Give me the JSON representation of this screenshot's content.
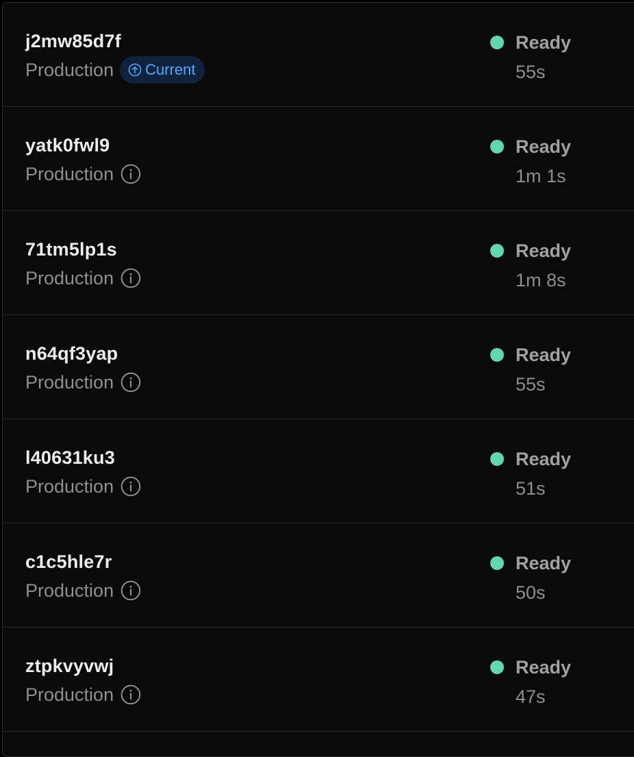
{
  "deployments": [
    {
      "id": "j2mw85d7f",
      "environment": "Production",
      "status": "Ready",
      "duration": "55s",
      "is_current": true,
      "current_label": "Current"
    },
    {
      "id": "yatk0fwl9",
      "environment": "Production",
      "status": "Ready",
      "duration": "1m 1s",
      "is_current": false
    },
    {
      "id": "71tm5lp1s",
      "environment": "Production",
      "status": "Ready",
      "duration": "1m 8s",
      "is_current": false
    },
    {
      "id": "n64qf3yap",
      "environment": "Production",
      "status": "Ready",
      "duration": "55s",
      "is_current": false
    },
    {
      "id": "l40631ku3",
      "environment": "Production",
      "status": "Ready",
      "duration": "51s",
      "is_current": false
    },
    {
      "id": "c1c5hle7r",
      "environment": "Production",
      "status": "Ready",
      "duration": "50s",
      "is_current": false
    },
    {
      "id": "ztpkvyvwj",
      "environment": "Production",
      "status": "Ready",
      "duration": "47s",
      "is_current": false
    }
  ],
  "colors": {
    "background": "#0a0a0a",
    "ready_dot": "#62d6b4",
    "current_badge_bg": "#10233d",
    "current_badge_text": "#52a8ff"
  },
  "icons": {
    "info": "info-circle-icon",
    "current": "arrow-up-circle-icon"
  }
}
